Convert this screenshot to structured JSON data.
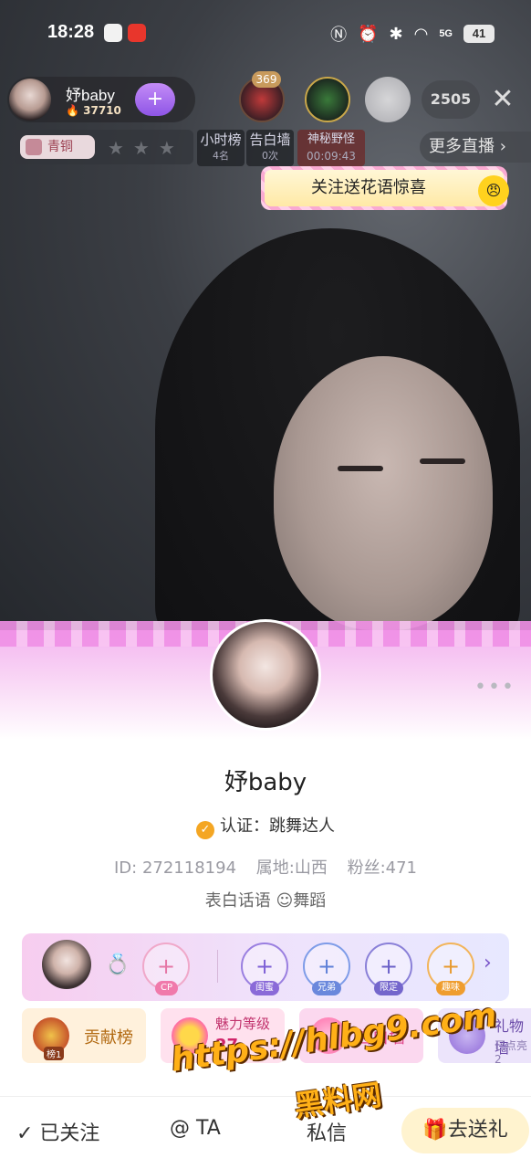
{
  "status_bar": {
    "time": "18:28",
    "battery": "41",
    "signal": "5G"
  },
  "host": {
    "name": "妤baby",
    "heat": "37710",
    "follow_icon": "+"
  },
  "viewers": {
    "rank_badge": "369",
    "count": "2505"
  },
  "level": {
    "tag": "青铜",
    "stars": "★★★"
  },
  "mini_boxes": [
    {
      "title": "小时榜",
      "sub": "4名"
    },
    {
      "title": "告白墙",
      "sub": "0次"
    },
    {
      "title": "神秘野怪",
      "sub": "00:09:43"
    }
  ],
  "more_live": "更多直播 ›",
  "banner_text": "关注送花语惊喜",
  "profile": {
    "name": "妤baby",
    "verify_label": "认证：跳舞达人",
    "id": "ID: 272118194",
    "location": "属地:山西",
    "fans": "粉丝:471",
    "tagline": "表白话语 ☺舞蹈"
  },
  "relations": [
    {
      "label": "CP",
      "plus": "+"
    },
    {
      "label": "闺蜜",
      "plus": "+"
    },
    {
      "label": "兄弟",
      "plus": "+"
    },
    {
      "label": "限定",
      "plus": "+"
    },
    {
      "label": "趣味",
      "plus": "+"
    }
  ],
  "features": {
    "contrib": "贡献榜",
    "contrib_rank": "榜1",
    "charm": "魅力等级",
    "charm_level": "27",
    "wall": "告白墙",
    "gift_wall": "礼物墙",
    "gift_wall_sub": "已点亮2"
  },
  "watermark": {
    "line1": "https://hlbg9.com",
    "line2": "黑料网"
  },
  "bottom": {
    "followed": "✓ 已关注",
    "at": "@ TA",
    "message": "私信",
    "gift": "🎁去送礼"
  }
}
